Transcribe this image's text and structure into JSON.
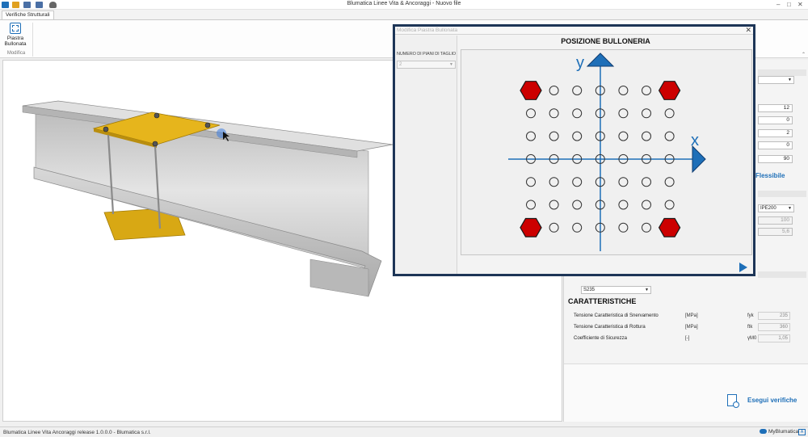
{
  "window": {
    "title": "Blumatica Linee Vita & Ancoraggi - Nuovo file",
    "controls": [
      "–",
      "□",
      "✕"
    ]
  },
  "quick_access": [
    "app-icon",
    "open-icon",
    "save-icon",
    "save-as-icon",
    "user-icon"
  ],
  "ribbon": {
    "tab": "Verifiche Strutturali",
    "button_line1": "Piastra",
    "button_line2": "Bullonata",
    "group": "Modifica",
    "collapse": "⌃"
  },
  "dialog": {
    "title": "Modifica Piastra Bullonata",
    "close": "✕",
    "heading": "POSIZIONE BULLONERIA",
    "shear_planes_label": "NUMERO DI PIANI DI TAGLIO",
    "shear_planes_value": "2",
    "x_axis_label": "x",
    "y_axis_label": "y",
    "grid_columns": 7,
    "grid_rows": 7,
    "active_bolts": [
      "top-left",
      "top-right",
      "bottom-left",
      "bottom-right"
    ],
    "bolt_color": "#cc0000",
    "axis_color": "#1e6fb8"
  },
  "right_panel": {
    "numeric_inputs": [
      "12",
      "0",
      "2",
      "0",
      "90"
    ],
    "flex_link": "Flessibile",
    "profile_select": "IPE200",
    "readonly_1": "100",
    "readonly_2": "5,6",
    "steel_select": "S235",
    "section_title": "CARATTERISTICHE",
    "rows": [
      {
        "label": "Tensione Caratteristica di Snervamento",
        "unit": "[MPa]",
        "symbol": "fyk",
        "value": "235"
      },
      {
        "label": "Tensione Caratteristica di Rottura",
        "unit": "[MPa]",
        "symbol": "ftk",
        "value": "360"
      },
      {
        "label": "Coefficiente di Sicurezza",
        "unit": "[-]",
        "symbol": "γM0",
        "value": "1,05"
      }
    ],
    "verify_button": "Esegui verifiche"
  },
  "status_bar": {
    "text": "Blumatica Linee Vita  Ancoraggi release 1.0.0.0 - Blumatica s.r.l.",
    "cloud_label": "MyBlumatica",
    "box_label": "A"
  },
  "colors": {
    "plate": "#e0b21a",
    "beam": "#c9c9c9",
    "accent": "#1e6fb8",
    "dialog_border": "#1d3557"
  }
}
